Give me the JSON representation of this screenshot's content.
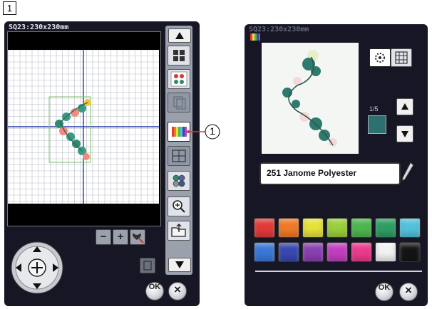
{
  "step_marker": "1",
  "callout_number": "1",
  "screen_edit": {
    "title": "SQ23:230x230mm",
    "sidebar_icons": [
      "arrow-up-icon",
      "layout-icon",
      "mirror-icon",
      "copy-icon",
      "color-icon",
      "group-icon",
      "color-sort-icon",
      "zoom-icon",
      "open-folder-icon",
      "arrow-down-icon"
    ],
    "zoom_minus": "−",
    "zoom_plus": "+",
    "ok_label": "OK",
    "close_label": "×"
  },
  "screen_color": {
    "title": "SQ23:230x230mm",
    "page_indicator": "1/5",
    "thread_name": "251 Janome Polyester",
    "current_color": "#2e7070",
    "palette": [
      [
        "#e23a3a",
        "#f07a28",
        "#e6e23a",
        "#9bcf3c",
        "#4fb64f",
        "#2f9e63",
        "#52c3dc"
      ],
      [
        "#3a78d8",
        "#3848b0",
        "#8a40b0",
        "#c23fc0",
        "#ec3a8c",
        "#f2f2f2",
        "#141414"
      ]
    ],
    "ok_label": "OK",
    "close_label": "×"
  }
}
